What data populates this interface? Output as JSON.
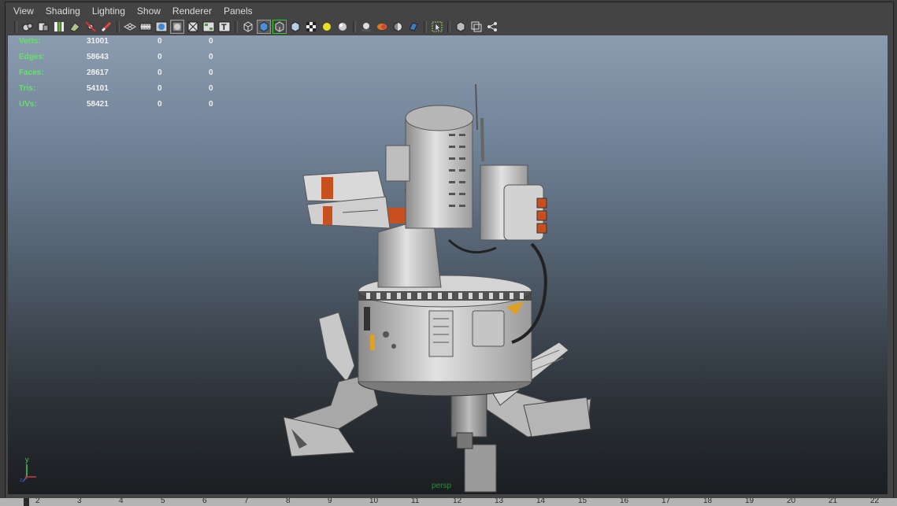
{
  "menu": [
    "View",
    "Shading",
    "Lighting",
    "Show",
    "Renderer",
    "Panels"
  ],
  "toolbar": {
    "icons": [
      "select-camera-icon",
      "camera-attributes-icon",
      "bookmark-icon",
      "image-plane-icon",
      "2d-pan-zoom-icon",
      "grease-pencil-icon",
      "separator",
      "grid-icon",
      "film-gate-icon",
      "resolution-gate-icon",
      "gate-mask-icon",
      "field-chart-icon",
      "safe-title-icon",
      "separator",
      "wireframe-icon",
      "smooth-shade-icon",
      "wireframe-on-shaded-icon",
      "bounding-box-icon",
      "textured-icon",
      "use-lights-icon",
      "shadows-icon",
      "separator",
      "screen-ambient-occlusion-icon",
      "motion-blur-icon",
      "depth-of-field-icon",
      "anti-alias-icon",
      "separator",
      "isolate-select-icon",
      "separator",
      "xray-icon",
      "xray-active-icon",
      "xray-joints-icon"
    ]
  },
  "hud": {
    "rows": [
      {
        "label": "Verts:",
        "v1": "31001",
        "v2": "0",
        "v3": "0"
      },
      {
        "label": "Edges:",
        "v1": "58643",
        "v2": "0",
        "v3": "0"
      },
      {
        "label": "Faces:",
        "v1": "28617",
        "v2": "0",
        "v3": "0"
      },
      {
        "label": "Tris:",
        "v1": "54101",
        "v2": "0",
        "v3": "0"
      },
      {
        "label": "UVs:",
        "v1": "58421",
        "v2": "0",
        "v3": "0"
      }
    ]
  },
  "camera": {
    "name": "persp"
  },
  "axis": {
    "y": "y",
    "x": "x",
    "z": "z"
  },
  "timeline": {
    "ticks": [
      "2",
      "3",
      "4",
      "5",
      "6",
      "7",
      "8",
      "9",
      "10",
      "11",
      "12",
      "13",
      "14",
      "15",
      "16",
      "17",
      "18",
      "19",
      "20",
      "21",
      "22"
    ]
  },
  "colors": {
    "hud_label": "#62e462",
    "hud_value": "#f0f0f0",
    "camera_label": "#2e8b3a",
    "accent_orange": "#c8501e"
  }
}
